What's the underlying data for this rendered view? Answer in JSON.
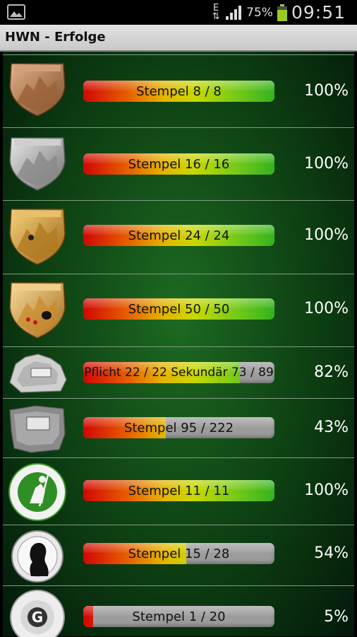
{
  "status_bar": {
    "network": "E",
    "battery_percent": "75%",
    "time": "09:51"
  },
  "action_bar": {
    "title": "HWN - Erfolge"
  },
  "achievements": [
    {
      "badge": "bronze-shield-badge",
      "label": "Stempel 8 / 8",
      "progress": 1.0,
      "percent": "100%"
    },
    {
      "badge": "silver-shield-badge",
      "label": "Stempel 16 / 16",
      "progress": 1.0,
      "percent": "100%"
    },
    {
      "badge": "gold-shield-badge",
      "label": "Stempel 24 / 24",
      "progress": 1.0,
      "percent": "100%"
    },
    {
      "badge": "gold-jewel-shield-badge",
      "label": "Stempel 50 / 50",
      "progress": 1.0,
      "percent": "100%"
    },
    {
      "badge": "stone-badge",
      "label": "Pflicht 22 / 22 Sekundär  73 / 89",
      "progress": 0.82,
      "percent": "82%"
    },
    {
      "badge": "granite-stone-badge",
      "label": "Stempel 95 / 222",
      "progress": 0.43,
      "percent": "43%"
    },
    {
      "badge": "green-hiker-round-badge",
      "label": "Stempel 11 / 11",
      "progress": 1.0,
      "percent": "100%"
    },
    {
      "badge": "silhouette-round-badge",
      "label": "Stempel 15 / 28",
      "progress": 0.54,
      "percent": "54%"
    },
    {
      "badge": "letter-g-round-badge",
      "label": "Stempel 1 / 20",
      "progress": 0.05,
      "percent": "5%"
    }
  ],
  "colors": {
    "list_background": "#0d3f12",
    "bar_empty": "#9c9c9c",
    "bar_start": "#d10606",
    "bar_end": "#33b31d"
  }
}
